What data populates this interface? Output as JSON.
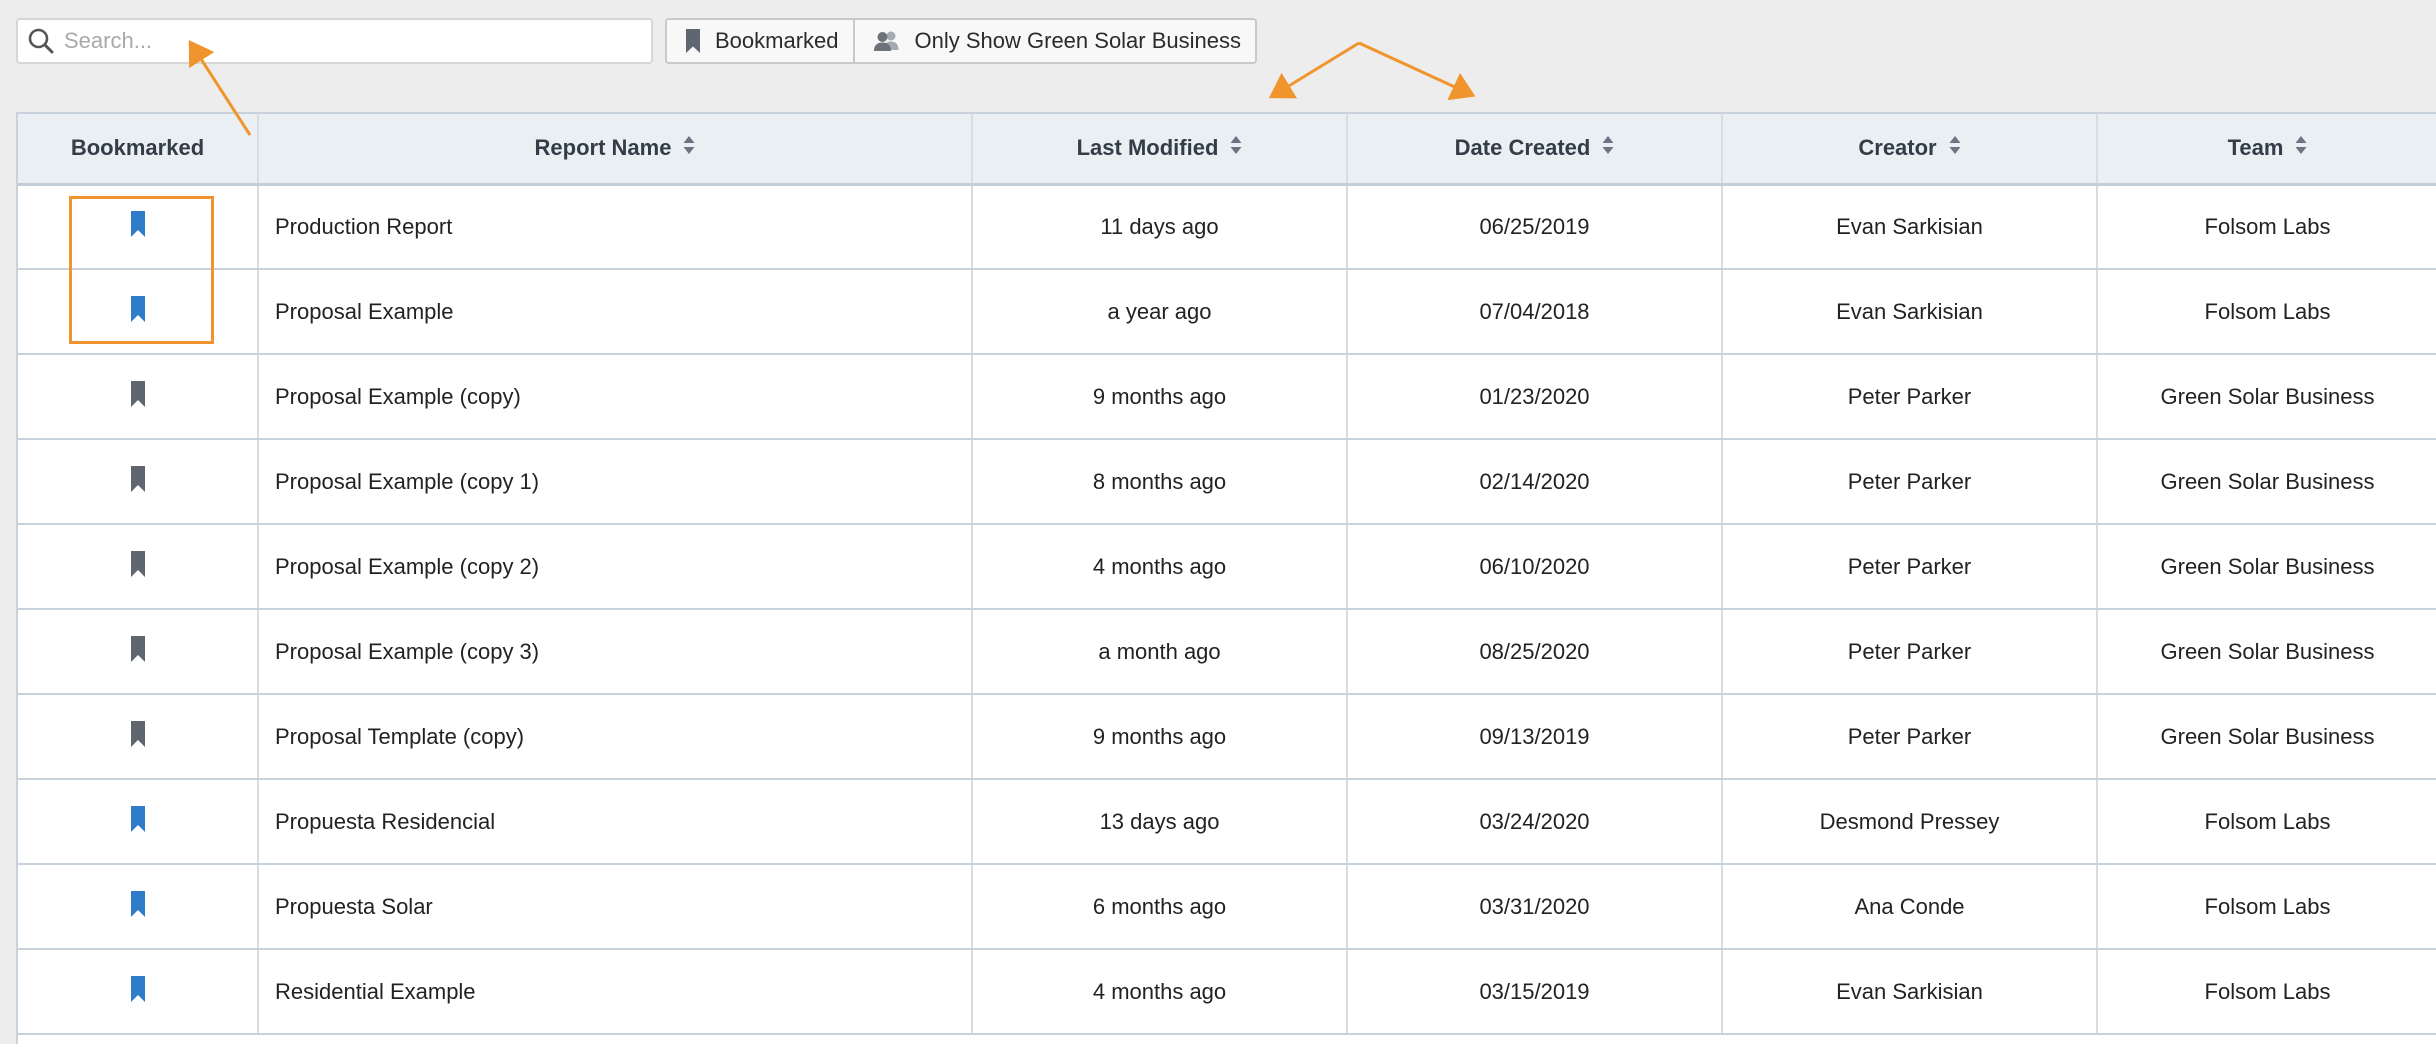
{
  "toolbar": {
    "search_placeholder": "Search...",
    "search_value": "",
    "bookmarked_label": "Bookmarked",
    "team_filter_label": "Only Show Green Solar Business"
  },
  "table": {
    "columns": [
      {
        "label": "Bookmarked",
        "sortable": false
      },
      {
        "label": "Report Name",
        "sortable": true
      },
      {
        "label": "Last Modified",
        "sortable": true
      },
      {
        "label": "Date Created",
        "sortable": true
      },
      {
        "label": "Creator",
        "sortable": true
      },
      {
        "label": "Team",
        "sortable": true
      }
    ],
    "rows": [
      {
        "bookmarked": true,
        "name": "Production Report",
        "modified": "11 days ago",
        "created": "06/25/2019",
        "creator": "Evan Sarkisian",
        "team": "Folsom Labs"
      },
      {
        "bookmarked": true,
        "name": "Proposal Example",
        "modified": "a year ago",
        "created": "07/04/2018",
        "creator": "Evan Sarkisian",
        "team": "Folsom Labs"
      },
      {
        "bookmarked": false,
        "name": "Proposal Example (copy)",
        "modified": "9 months ago",
        "created": "01/23/2020",
        "creator": "Peter Parker",
        "team": "Green Solar Business"
      },
      {
        "bookmarked": false,
        "name": "Proposal Example (copy 1)",
        "modified": "8 months ago",
        "created": "02/14/2020",
        "creator": "Peter Parker",
        "team": "Green Solar Business"
      },
      {
        "bookmarked": false,
        "name": "Proposal Example (copy 2)",
        "modified": "4 months ago",
        "created": "06/10/2020",
        "creator": "Peter Parker",
        "team": "Green Solar Business"
      },
      {
        "bookmarked": false,
        "name": "Proposal Example (copy 3)",
        "modified": "a month ago",
        "created": "08/25/2020",
        "creator": "Peter Parker",
        "team": "Green Solar Business"
      },
      {
        "bookmarked": false,
        "name": "Proposal Template (copy)",
        "modified": "9 months ago",
        "created": "09/13/2019",
        "creator": "Peter Parker",
        "team": "Green Solar Business"
      },
      {
        "bookmarked": true,
        "name": "Propuesta Residencial",
        "modified": "13 days ago",
        "created": "03/24/2020",
        "creator": "Desmond Pressey",
        "team": "Folsom Labs"
      },
      {
        "bookmarked": true,
        "name": "Propuesta Solar",
        "modified": "6 months ago",
        "created": "03/31/2020",
        "creator": "Ana Conde",
        "team": "Folsom Labs"
      },
      {
        "bookmarked": true,
        "name": "Residential Example",
        "modified": "4 months ago",
        "created": "03/15/2019",
        "creator": "Evan Sarkisian",
        "team": "Folsom Labs"
      }
    ]
  },
  "icons": {
    "search": "search-icon",
    "bookmark": "bookmark-icon",
    "team": "users-icon",
    "sort": "sort-icon"
  },
  "colors": {
    "bookmark_active": "#2f7dc9",
    "bookmark_inactive": "#5f6670",
    "annotation": "#f0952d",
    "header_bg": "#eaeff4"
  }
}
